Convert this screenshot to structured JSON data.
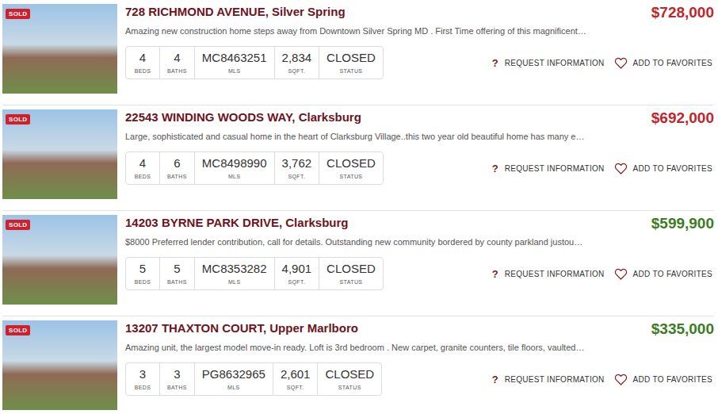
{
  "listings": [
    {
      "badge": "SOLD",
      "title": "728 RICHMOND AVENUE, Silver Spring",
      "price": "$728,000",
      "color": "#c0272d",
      "description": "Amazing new construction home steps away from Downtown Silver Spring MD . First Time offering of this magnificent…",
      "stats": [
        {
          "value": "4",
          "label": "BEDS"
        },
        {
          "value": "4",
          "label": "BATHS"
        },
        {
          "value": "MC8463251",
          "label": "MLS"
        },
        {
          "value": "2,834",
          "label": "SQFT."
        },
        {
          "value": "CLOSED",
          "label": "STATUS"
        }
      ],
      "actions": [
        {
          "kind": "question",
          "icon": "?",
          "label": "REQUEST INFORMATION"
        },
        {
          "kind": "heart",
          "icon": "",
          "label": "ADD TO FAVORITES"
        }
      ]
    },
    {
      "badge": "SOLD",
      "title": "22543 WINDING WOODS WAY, Clarksburg",
      "price": "$692,000",
      "color": "#c0272d",
      "description": "Large, sophisticated and casual home in the heart of Clarksburg Village..this two year old beautiful home has many e…",
      "stats": [
        {
          "value": "4",
          "label": "BEDS"
        },
        {
          "value": "6",
          "label": "BATHS"
        },
        {
          "value": "MC8498990",
          "label": "MLS"
        },
        {
          "value": "3,762",
          "label": "SQFT."
        },
        {
          "value": "CLOSED",
          "label": "STATUS"
        }
      ],
      "actions": [
        {
          "kind": "question",
          "icon": "?",
          "label": "REQUEST INFORMATION"
        },
        {
          "kind": "heart",
          "icon": "",
          "label": "ADD TO FAVORITES"
        }
      ]
    },
    {
      "badge": "SOLD",
      "title": "14203 BYRNE PARK DRIVE, Clarksburg",
      "price": "$599,900",
      "color": "#3b7d23",
      "description": "$8000 Preferred lender contribution, call for details. Outstanding new community bordered by county parkland justou…",
      "stats": [
        {
          "value": "5",
          "label": "BEDS"
        },
        {
          "value": "5",
          "label": "BATHS"
        },
        {
          "value": "MC8353282",
          "label": "MLS"
        },
        {
          "value": "4,901",
          "label": "SQFT."
        },
        {
          "value": "CLOSED",
          "label": "STATUS"
        }
      ],
      "actions": [
        {
          "kind": "question",
          "icon": "?",
          "label": "REQUEST INFORMATION"
        },
        {
          "kind": "heart",
          "icon": "",
          "label": "ADD TO FAVORITES"
        }
      ]
    },
    {
      "badge": "SOLD",
      "title": "13207 THAXTON COURT, Upper Marlboro",
      "price": "$335,000",
      "color": "#3b7d23",
      "description": "Amazing unit, the largest model move-in ready. Loft is 3rd bedroom . New carpet, granite counters, tile floors, vaulted…",
      "stats": [
        {
          "value": "3",
          "label": "BEDS"
        },
        {
          "value": "3",
          "label": "BATHS"
        },
        {
          "value": "PG8632965",
          "label": "MLS"
        },
        {
          "value": "2,601",
          "label": "SQFT."
        },
        {
          "value": "CLOSED",
          "label": "STATUS"
        }
      ],
      "actions": [
        {
          "kind": "question",
          "icon": "?",
          "label": "REQUEST INFORMATION"
        },
        {
          "kind": "heart",
          "icon": "",
          "label": "ADD TO FAVORITES"
        }
      ]
    }
  ]
}
